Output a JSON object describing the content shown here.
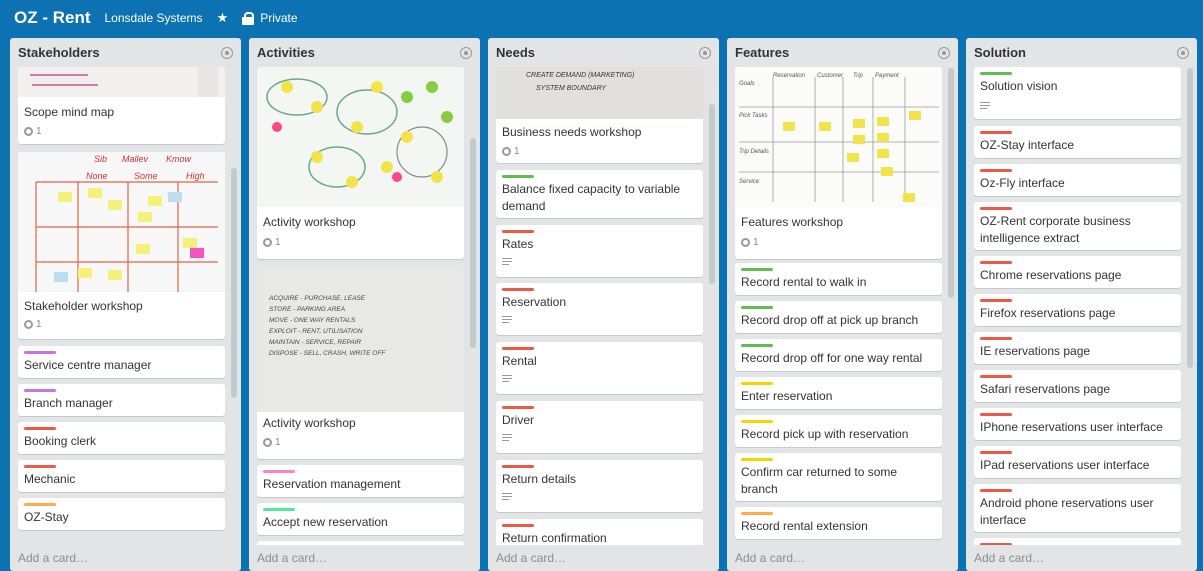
{
  "board": {
    "title": "OZ - Rent",
    "team": "Lonsdale Systems",
    "star_icon": "star-icon",
    "privacy_icon": "lock-icon",
    "privacy": "Private"
  },
  "colors": {
    "background": "#0c72b2",
    "list": "#e2e4e6",
    "label_red": "#eb5a46",
    "label_green": "#61bd4f",
    "label_purple": "#c377e0",
    "label_orange": "#ffab4a",
    "label_yellow": "#f2d600",
    "label_pink": "#ff80ce",
    "label_mint": "#51e898"
  },
  "add_card": "Add a card…",
  "lists": [
    {
      "title": "Stakeholders",
      "cards": [
        {
          "title": "Scope mind map",
          "attachments": "1"
        },
        {
          "title": "Stakeholder workshop",
          "attachments": "1",
          "photo_texts": [
            "Sib",
            "Mallev",
            "Kmow",
            "None",
            "Some",
            "High"
          ]
        },
        {
          "title": "Service centre manager",
          "label": "purple"
        },
        {
          "title": "Branch manager",
          "label": "purple"
        },
        {
          "title": "Booking clerk",
          "label": "red"
        },
        {
          "title": "Mechanic",
          "label": "red"
        },
        {
          "title": "OZ-Stay",
          "label": "orange"
        }
      ]
    },
    {
      "title": "Activities",
      "cards": [
        {
          "title": "Activity workshop",
          "attachments": "1"
        },
        {
          "title": "Activity workshop",
          "attachments": "1",
          "photo_lines": [
            "ACQUIRE - PURCHASE, LEASE",
            "STORE - PARKING AREA",
            "MOVE - ONE WAY RENTALS",
            "EXPLOIT - RENT, UTILISATION",
            "MAINTAIN - SERVICE, REPAIR",
            "DISPOSE - SELL, CRASH, WRITE OFF"
          ]
        },
        {
          "title": "Reservation management",
          "label": "pink"
        },
        {
          "title": "Accept new reservation",
          "label": "mint"
        }
      ]
    },
    {
      "title": "Needs",
      "cards": [
        {
          "title": "Business needs workshop",
          "attachments": "1",
          "photo_lines": [
            "CREATE DEMAND (MARKETING)",
            "SYSTEM BOUNDARY"
          ]
        },
        {
          "title": "Balance fixed capacity to variable demand",
          "label": "green"
        },
        {
          "title": "Rates",
          "label": "red",
          "description": true
        },
        {
          "title": "Reservation",
          "label": "red",
          "description": true
        },
        {
          "title": "Rental",
          "label": "red",
          "description": true
        },
        {
          "title": "Driver",
          "label": "red",
          "description": true
        },
        {
          "title": "Return details",
          "label": "red",
          "description": true
        },
        {
          "title": "Return confirmation",
          "label": "red"
        }
      ]
    },
    {
      "title": "Features",
      "cards": [
        {
          "title": "Features workshop",
          "attachments": "1",
          "photo_texts": [
            "Goals",
            "Reservation",
            "Customer",
            "Trip",
            "Payment",
            "Pick Tasks",
            "Trip Details",
            "Service"
          ]
        },
        {
          "title": "Record rental to walk in",
          "label": "green"
        },
        {
          "title": "Record drop off at pick up branch",
          "label": "green"
        },
        {
          "title": "Record drop off for one way rental",
          "label": "green"
        },
        {
          "title": "Enter reservation",
          "label": "yellow"
        },
        {
          "title": "Record pick up with reservation",
          "label": "yellow"
        },
        {
          "title": "Confirm car returned to some branch",
          "label": "yellow"
        },
        {
          "title": "Record rental extension",
          "label": "orange"
        }
      ]
    },
    {
      "title": "Solution",
      "cards": [
        {
          "title": "Solution vision",
          "label": "green",
          "description": true
        },
        {
          "title": "OZ-Stay interface",
          "label": "red"
        },
        {
          "title": "Oz-Fly interface",
          "label": "red"
        },
        {
          "title": "OZ-Rent corporate business intelligence extract",
          "label": "red"
        },
        {
          "title": "Chrome reservations page",
          "label": "red"
        },
        {
          "title": "Firefox reservations page",
          "label": "red"
        },
        {
          "title": "IE reservations page",
          "label": "red"
        },
        {
          "title": "Safari reservations page",
          "label": "red"
        },
        {
          "title": "IPhone reservations user interface",
          "label": "red"
        },
        {
          "title": "IPad reservations user interface",
          "label": "red"
        },
        {
          "title": "Android phone reservations user interface",
          "label": "red"
        }
      ]
    }
  ]
}
